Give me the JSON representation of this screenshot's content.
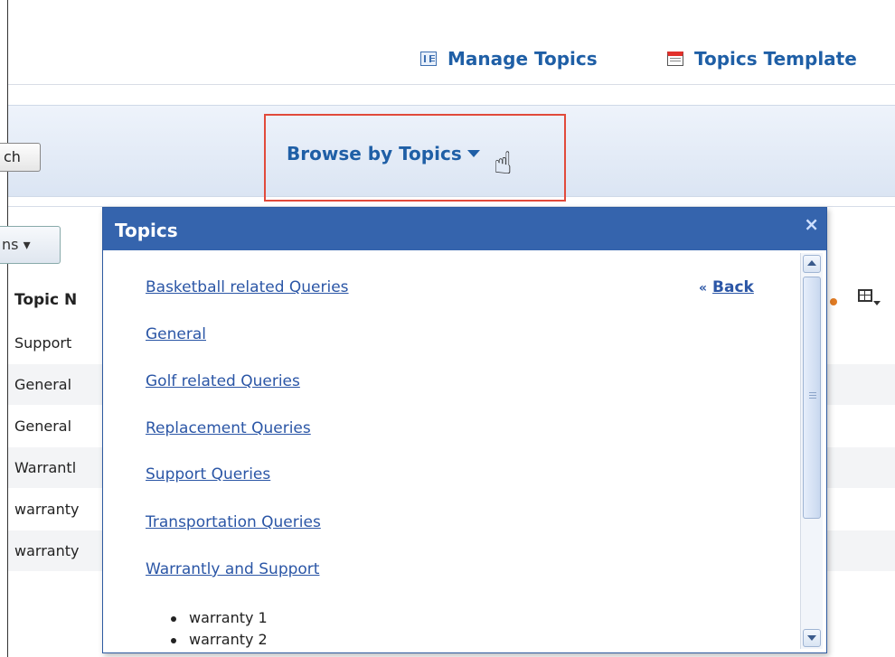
{
  "header": {
    "manage_topics": "Manage Topics",
    "topics_templates": "Topics Template"
  },
  "toolbar": {
    "search_label": "ch",
    "browse_label": "Browse by Topics",
    "actions_label": "ns"
  },
  "table": {
    "column_header": "Topic N",
    "rows": [
      "Support",
      "General",
      "General",
      "Warrantl",
      "warranty",
      "warranty"
    ]
  },
  "popup": {
    "title": "Topics",
    "close": "×",
    "back_label": "Back",
    "back_arrow": "«",
    "topics": [
      "Basketball related Queries",
      "General",
      "Golf related Queries",
      "Replacement Queries",
      "Support Queries",
      "Transportation Queries",
      "Warrantly and Support"
    ],
    "subitems": [
      "warranty 1",
      "warranty 2"
    ]
  },
  "colors": {
    "link_blue": "#1f5fa6",
    "popup_header": "#3564ad",
    "highlight_red": "#e14a3b"
  },
  "icons": [
    "list-icon",
    "template-icon",
    "chevron-down-icon",
    "hand-cursor-icon",
    "close-icon",
    "grid-icon",
    "scroll-up-icon",
    "scroll-down-icon"
  ]
}
